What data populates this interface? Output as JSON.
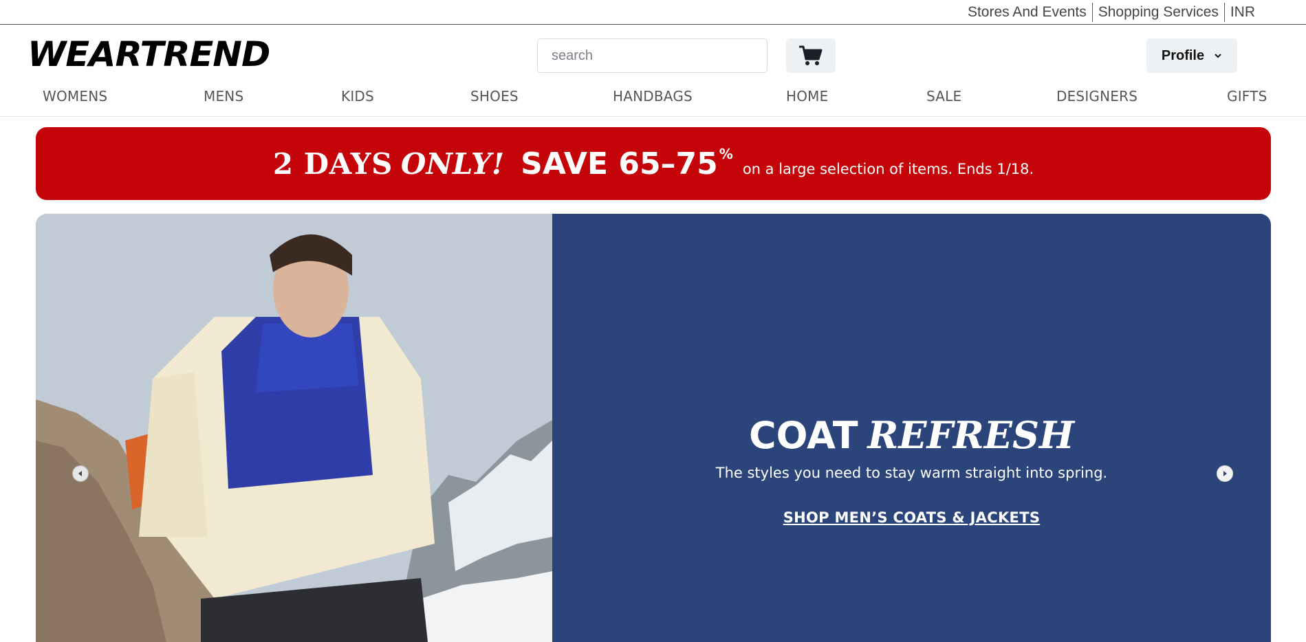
{
  "utility": {
    "links": [
      "Stores And Events",
      "Shopping Services",
      "INR"
    ]
  },
  "header": {
    "logo": "WEARTREND",
    "search_placeholder": "search",
    "profile_label": "Profile"
  },
  "nav": {
    "items": [
      "WOMENS",
      "MENS",
      "KIDS",
      "SHOES",
      "HANDBAGS",
      "HOME",
      "SALE",
      "DESIGNERS",
      "GIFTS"
    ]
  },
  "promo": {
    "days": "2 DAYS",
    "only": "ONLY!",
    "save": "SAVE 65–75",
    "percent": "%",
    "detail": "on a large selection of items. Ends 1/18.",
    "background": "#c40408"
  },
  "hero": {
    "title_plain": "COAT",
    "title_italic": "REFRESH",
    "subtitle": "The styles you need to stay warm straight into spring.",
    "cta": "SHOP MEN’S COATS & JACKETS",
    "panel_color": "#2b457b"
  }
}
